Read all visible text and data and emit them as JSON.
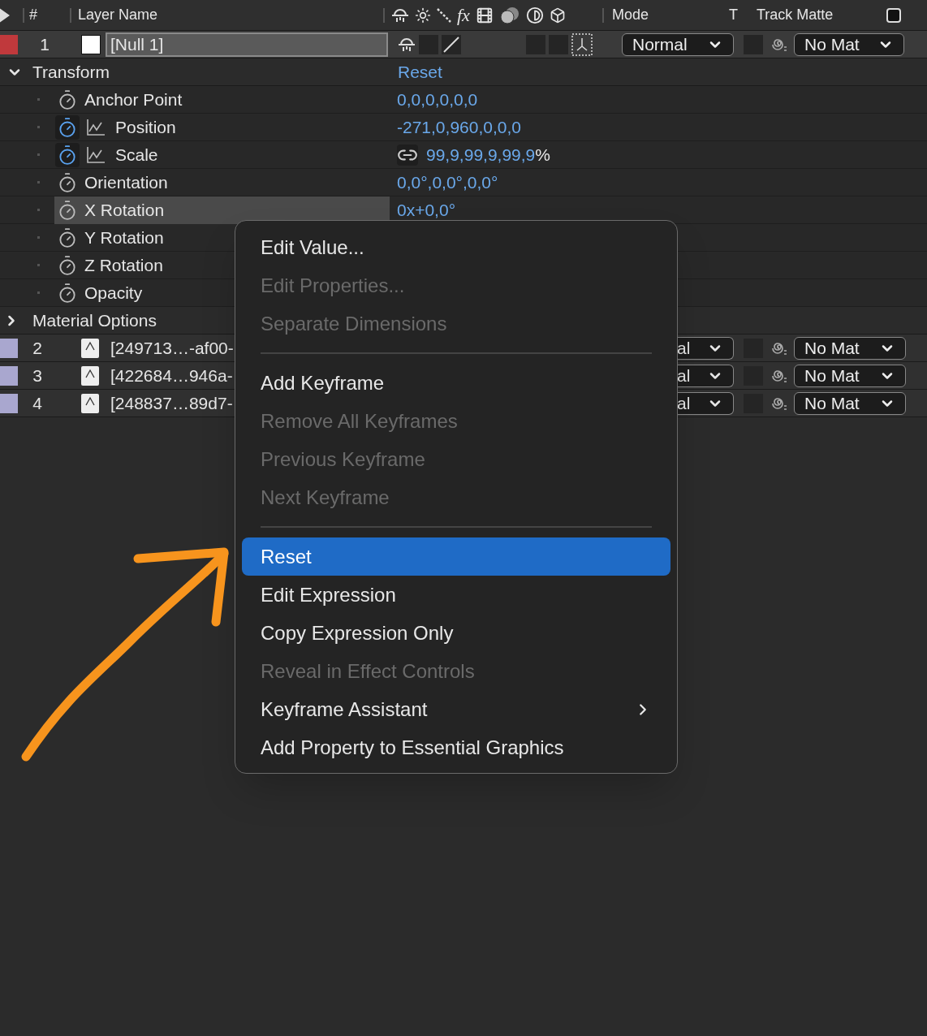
{
  "header": {
    "number": "#",
    "layer_name": "Layer Name",
    "fx": "fx",
    "mode": "Mode",
    "t": "T",
    "track_matte": "Track Matte"
  },
  "top_layer": {
    "color": "#c0393c",
    "number": "1",
    "name": "[Null 1]",
    "mode": "Normal",
    "track_matte": "No Mat"
  },
  "transform": {
    "label": "Transform",
    "expanded": true,
    "value": "Reset",
    "properties": [
      {
        "name": "Anchor Point",
        "value": "0,0,0,0,0,0",
        "keyframed": false,
        "selected": false
      },
      {
        "name": "Position",
        "value": "-271,0,960,0,0,0",
        "keyframed": true,
        "selected": false
      },
      {
        "name": "Scale",
        "value": "99,9,99,9,99,9",
        "unit": "%",
        "linked": true,
        "keyframed": true,
        "selected": false
      },
      {
        "name": "Orientation",
        "value": "0,0°,0,0°,0,0°",
        "keyframed": false,
        "selected": false
      },
      {
        "name": "X Rotation",
        "value": "0x+0,0°",
        "keyframed": false,
        "selected": true
      },
      {
        "name": "Y Rotation",
        "keyframed": false,
        "selected": false
      },
      {
        "name": "Z Rotation",
        "keyframed": false,
        "selected": false
      },
      {
        "name": "Opacity",
        "keyframed": false,
        "selected": false
      }
    ]
  },
  "material_options": {
    "label": "Material Options",
    "expanded": false
  },
  "layers": [
    {
      "color": "#a9a7cf",
      "number": "2",
      "name": "[249713…-af00-",
      "mode": "al",
      "track_matte": "No Mat"
    },
    {
      "color": "#a9a7cf",
      "number": "3",
      "name": "[422684…946a-",
      "mode": "al",
      "track_matte": "No Mat"
    },
    {
      "color": "#a9a7cf",
      "number": "4",
      "name": "[248837…89d7-",
      "mode": "al",
      "track_matte": "No Mat"
    }
  ],
  "context_menu": {
    "items": [
      {
        "kind": "item",
        "label": "Edit Value...",
        "disabled": false,
        "selected": false
      },
      {
        "kind": "item",
        "label": "Edit Properties...",
        "disabled": true,
        "selected": false
      },
      {
        "kind": "item",
        "label": "Separate Dimensions",
        "disabled": true,
        "selected": false
      },
      {
        "kind": "separator"
      },
      {
        "kind": "item",
        "label": "Add Keyframe",
        "disabled": false,
        "selected": false
      },
      {
        "kind": "item",
        "label": "Remove All Keyframes",
        "disabled": true,
        "selected": false
      },
      {
        "kind": "item",
        "label": "Previous Keyframe",
        "disabled": true,
        "selected": false
      },
      {
        "kind": "item",
        "label": "Next Keyframe",
        "disabled": true,
        "selected": false
      },
      {
        "kind": "separator"
      },
      {
        "kind": "item",
        "label": "Reset",
        "disabled": false,
        "selected": true
      },
      {
        "kind": "item",
        "label": "Edit Expression",
        "disabled": false,
        "selected": false
      },
      {
        "kind": "item",
        "label": "Copy Expression Only",
        "disabled": false,
        "selected": false
      },
      {
        "kind": "item",
        "label": "Reveal in Effect Controls",
        "disabled": true,
        "selected": false
      },
      {
        "kind": "item",
        "label": "Keyframe Assistant",
        "disabled": false,
        "selected": false,
        "submenu": true
      },
      {
        "kind": "item",
        "label": "Add Property to Essential Graphics",
        "disabled": false,
        "selected": false
      }
    ]
  }
}
